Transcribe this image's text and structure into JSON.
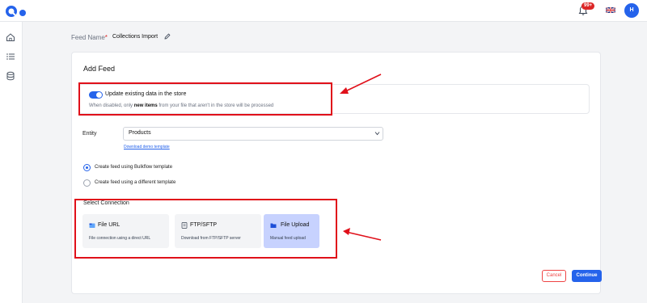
{
  "header": {
    "notification_badge": "99+",
    "avatar_initial": "H"
  },
  "feed": {
    "name_label": "Feed Name",
    "required_mark": "*",
    "name_value": "Collections Import"
  },
  "card": {
    "title": "Add Feed",
    "update_toggle": {
      "label": "Update existing data in the store",
      "enabled": true,
      "desc_prefix": "When disabled, only ",
      "desc_bold": "new items",
      "desc_suffix": " from your file that aren't in the store will be processed"
    },
    "entity": {
      "label": "Entity",
      "value": "Products",
      "template_link": "Download demo template"
    },
    "template_options": [
      {
        "label": "Create feed using Bulkflow template",
        "selected": true
      },
      {
        "label": "Create feed using a different template",
        "selected": false
      }
    ],
    "connection": {
      "title": "Select Connection",
      "options": [
        {
          "name": "File URL",
          "desc": "File connection using a direct URL",
          "icon": "file-url-icon",
          "active": false
        },
        {
          "name": "FTP/SFTP",
          "desc": "Download from FTP/SFTP server",
          "icon": "server-icon",
          "active": false
        },
        {
          "name": "File Upload",
          "desc": "Manual feed upload",
          "icon": "folder-icon",
          "active": true
        }
      ]
    }
  },
  "actions": {
    "cancel": "Cancel",
    "continue": "Continue"
  },
  "colors": {
    "accent": "#2563eb",
    "annotation": "#e0101a",
    "active_card": "#c7d2fe"
  }
}
